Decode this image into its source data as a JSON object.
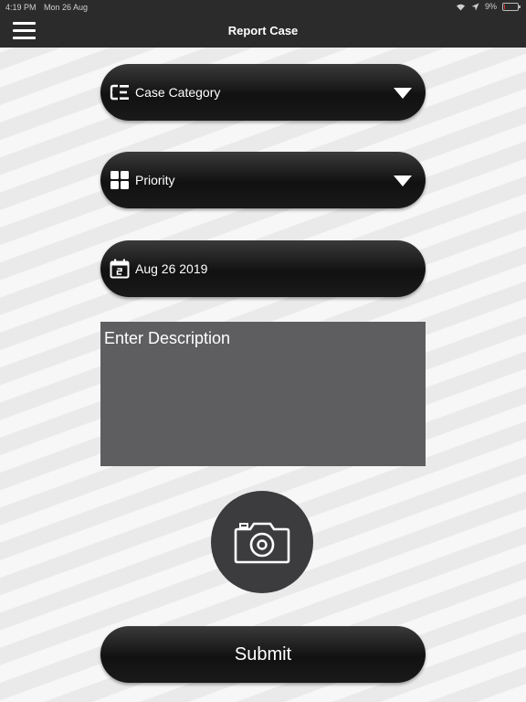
{
  "status_bar": {
    "time": "4:19 PM",
    "date": "Mon 26 Aug",
    "battery": "9%",
    "battery_level": 0.09
  },
  "nav": {
    "title": "Report Case",
    "menu_icon": "hamburger-menu-icon"
  },
  "form": {
    "case_category": {
      "label": "Case Category",
      "icon": "category-list-icon"
    },
    "priority": {
      "label": "Priority",
      "icon": "grid-icon"
    },
    "date": {
      "value": "Aug 26 2019",
      "icon": "calendar-icon"
    },
    "description": {
      "placeholder": "Enter Description",
      "value": ""
    },
    "camera": {
      "icon": "camera-icon"
    },
    "submit_label": "Submit"
  },
  "colors": {
    "bar": "#2b2b2b",
    "pill": "#1a1a1a",
    "description_bg": "#5e5d60",
    "camera_bg": "#3c3c3e",
    "background": "#eeeeee"
  }
}
